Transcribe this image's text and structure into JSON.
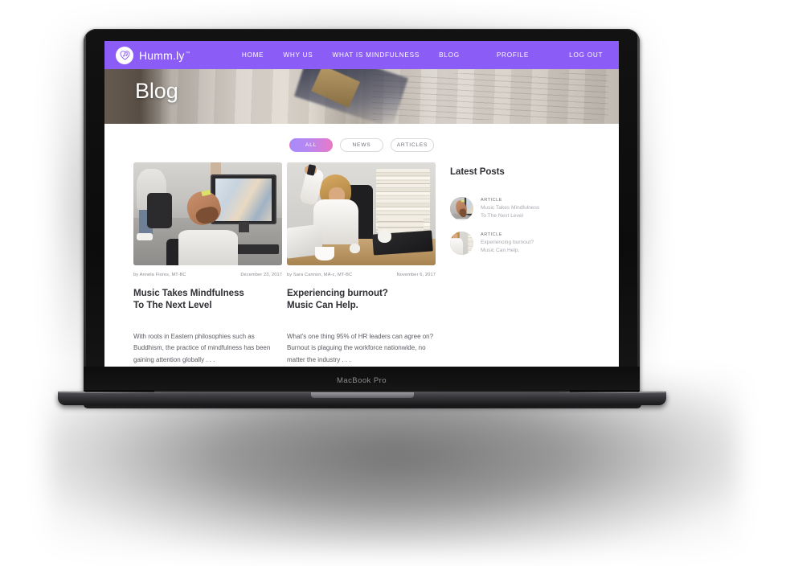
{
  "device": {
    "model_label": "MacBook Pro"
  },
  "site": {
    "brand": {
      "name": "Humm.ly",
      "trademark": "™",
      "logo_icon": "heart-music-note-icon",
      "accent_color": "#8b5cf6"
    },
    "nav": {
      "items": [
        {
          "label": "HOME"
        },
        {
          "label": "WHY US"
        },
        {
          "label": "WHAT IS MINDFULNESS"
        },
        {
          "label": "BLOG"
        },
        {
          "label": "PROFILE"
        },
        {
          "label": "LOG OUT"
        }
      ]
    },
    "hero": {
      "title": "Blog",
      "background_image": "open-notebook-photo"
    },
    "filters": {
      "items": [
        {
          "label": "ALL",
          "active": true
        },
        {
          "label": "NEWS",
          "active": false
        },
        {
          "label": "ARTICLES",
          "active": false
        }
      ],
      "active_gradient_from": "#a78bfa",
      "active_gradient_to": "#e879c8"
    },
    "posts": [
      {
        "image": "office-man-leaning-back-laughing-photo",
        "byline": "by Annela Flores, MT-BC",
        "date": "December 23, 2017",
        "title": "Music Takes Mindfulness\nTo The Next Level",
        "excerpt": "With roots in Eastern philosophies such as Buddhism, the practice of mindfulness has been gaining attention globally . . ."
      },
      {
        "image": "stressed-woman-desk-books-photo",
        "byline": "by Sara Cannon, MA-c, MT-BC",
        "date": "November 6, 2017",
        "title": "Experiencing burnout?\nMusic Can Help.",
        "excerpt": "What's one thing 95% of HR leaders can agree on? Burnout is plaguing the workforce nationwide, no matter the industry . . ."
      }
    ],
    "sidebar": {
      "title": "Latest Posts",
      "items": [
        {
          "kicker": "ARTICLE",
          "title": "Music Takes Mindfulness\nTo The Next Level",
          "thumb": "office-man-leaning-back-laughing-photo"
        },
        {
          "kicker": "ARTICLE",
          "title": "Experiencing burnout?\nMusic Can Help.",
          "thumb": "stressed-woman-desk-books-photo"
        }
      ]
    }
  }
}
